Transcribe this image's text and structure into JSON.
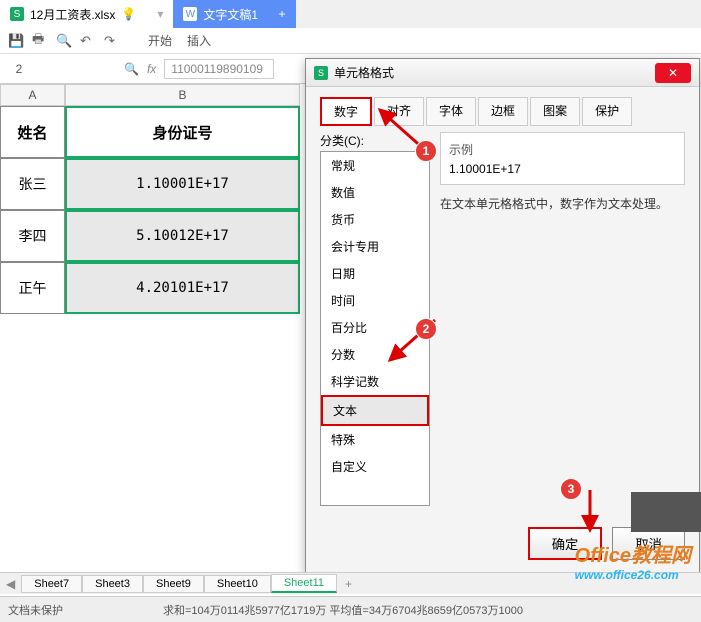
{
  "tabs": {
    "file1": "12月工资表.xlsx",
    "file2": "文字文稿1",
    "bulb": "●"
  },
  "menu": {
    "items": [
      "开始",
      "插入"
    ]
  },
  "formula": {
    "cell_ref": "2",
    "fx": "fx",
    "value": "11000119890109"
  },
  "sheet": {
    "col_a": "A",
    "col_b": "B",
    "header_a": "姓名",
    "header_b": "身份证号",
    "rows": [
      {
        "name": "张三",
        "id": "1.10001E+17"
      },
      {
        "name": "李四",
        "id": "5.10012E+17"
      },
      {
        "name": "正午",
        "id": "4.20101E+17"
      }
    ]
  },
  "dialog": {
    "title": "单元格格式",
    "tabs": [
      "数字",
      "对齐",
      "字体",
      "边框",
      "图案",
      "保护"
    ],
    "category_label": "分类(C):",
    "categories": [
      "常规",
      "数值",
      "货币",
      "会计专用",
      "日期",
      "时间",
      "百分比",
      "分数",
      "科学记数",
      "文本",
      "特殊",
      "自定义"
    ],
    "preview_label": "示例",
    "preview_value": "1.10001E+17",
    "description": "在文本单元格格式中，数字作为文本处理。",
    "ok": "确定",
    "cancel": "取消"
  },
  "annotations": {
    "b1": "1",
    "b2": "2",
    "b3": "3"
  },
  "sheet_tabs": [
    "Sheet7",
    "Sheet3",
    "Sheet9",
    "Sheet10",
    "Sheet11"
  ],
  "status": {
    "protect": "文档未保护",
    "stats": "求和=104万0114兆5977亿1719万    平均值=34万6704兆8659亿0573万1000"
  },
  "watermark": {
    "line1": "Office教程网",
    "line2": "www.office26.com"
  }
}
